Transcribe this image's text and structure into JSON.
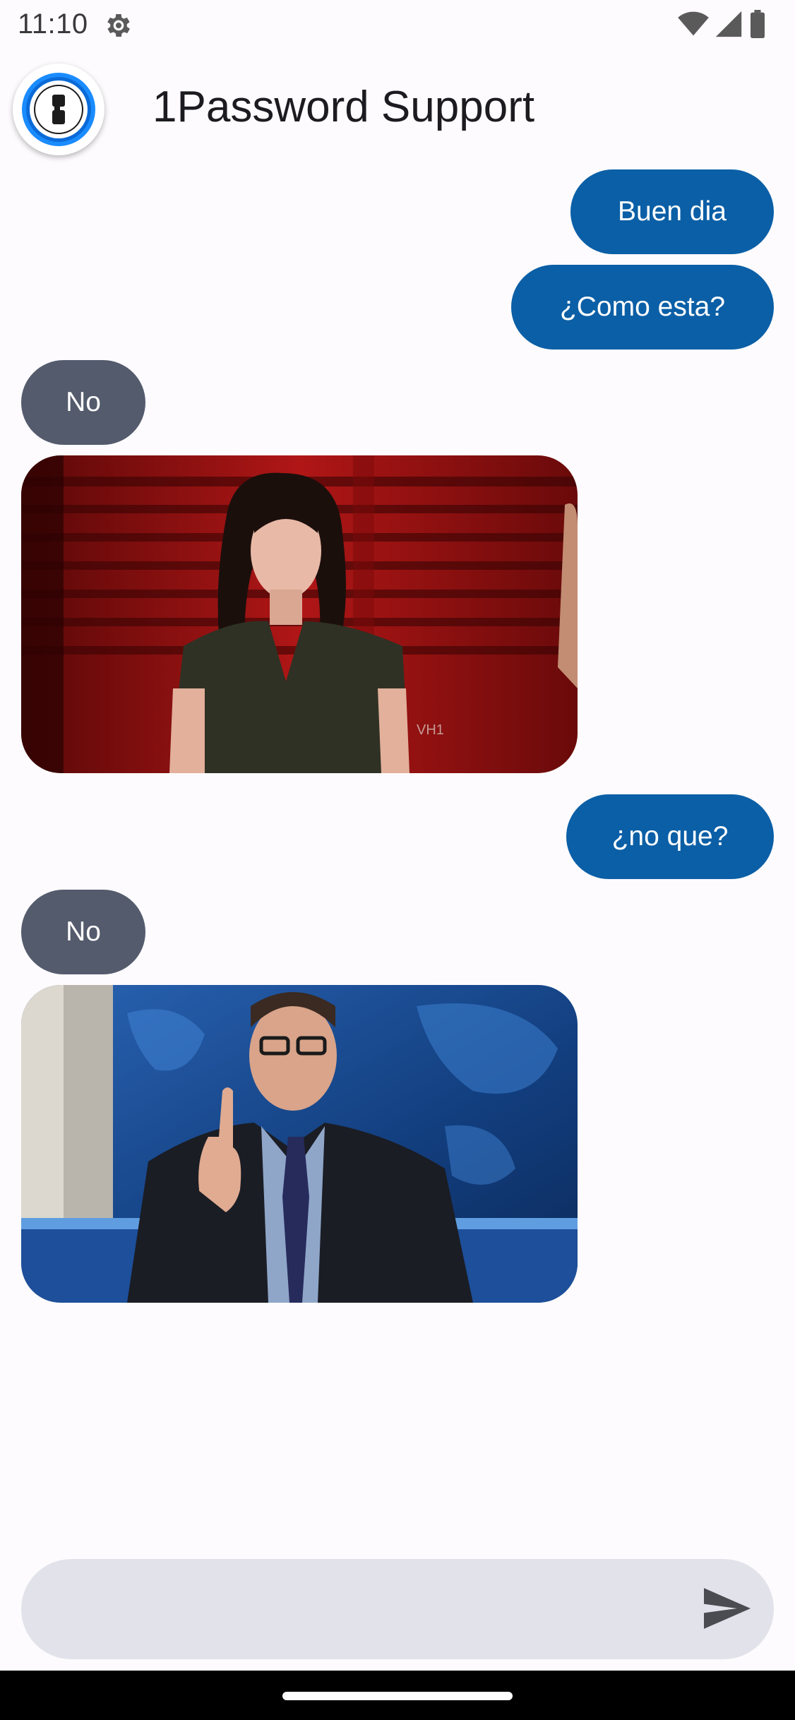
{
  "status_bar": {
    "time": "11:10",
    "icons": [
      "settings-gear-icon",
      "wifi-icon",
      "cell-signal-icon",
      "battery-icon"
    ]
  },
  "header": {
    "title": "1Password Support",
    "logo_icon": "1password-logo-icon"
  },
  "messages": [
    {
      "kind": "text",
      "direction": "outgoing",
      "text": "Buen dia"
    },
    {
      "kind": "text",
      "direction": "outgoing",
      "text": "¿Como esta?"
    },
    {
      "kind": "text",
      "direction": "incoming",
      "text": "No"
    },
    {
      "kind": "gif",
      "direction": "incoming",
      "caption_text": "VH1"
    },
    {
      "kind": "text",
      "direction": "outgoing",
      "text": "¿no que?"
    },
    {
      "kind": "text",
      "direction": "incoming",
      "text": "No"
    },
    {
      "kind": "gif",
      "direction": "incoming"
    }
  ],
  "composer": {
    "value": "",
    "placeholder": "",
    "send_icon": "send-icon"
  },
  "colors": {
    "background": "#fdfbfd",
    "outgoing_bubble": "#0b5fa6",
    "incoming_bubble": "#545b6d",
    "composer_background": "#e2e3ea",
    "nav_bar": "#000000"
  }
}
